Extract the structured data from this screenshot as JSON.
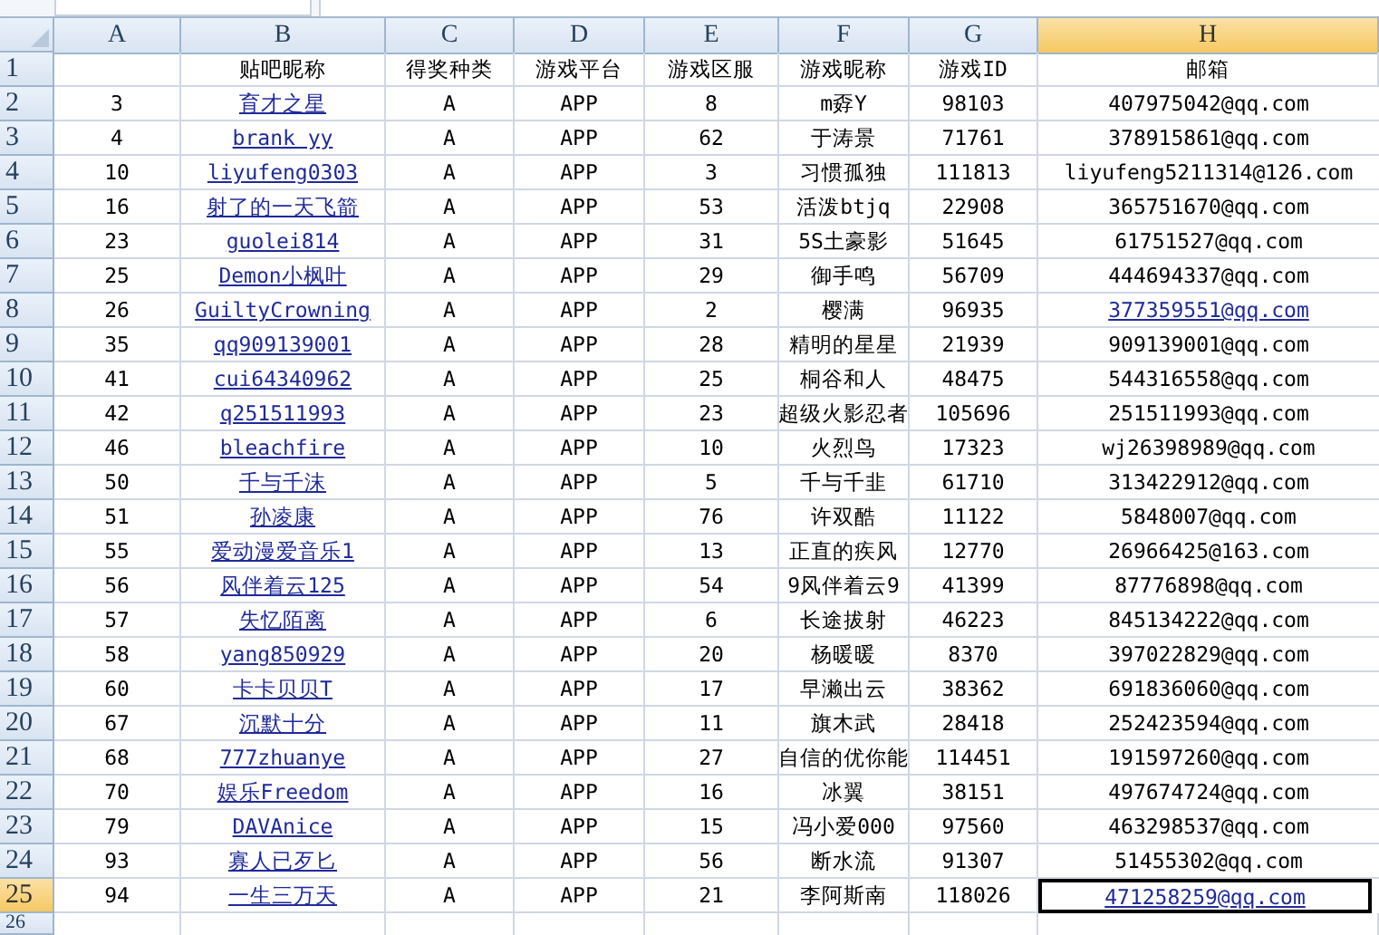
{
  "columns": [
    {
      "label": "A",
      "selected": false
    },
    {
      "label": "B",
      "selected": false
    },
    {
      "label": "C",
      "selected": false
    },
    {
      "label": "D",
      "selected": false
    },
    {
      "label": "E",
      "selected": false
    },
    {
      "label": "F",
      "selected": false
    },
    {
      "label": "G",
      "selected": false
    },
    {
      "label": "H",
      "selected": true
    }
  ],
  "header_row": {
    "number": "1",
    "titles": [
      "贴吧昵称",
      "得奖种类",
      "游戏平台",
      "游戏区服",
      "游戏昵称",
      "游戏ID",
      "邮箱"
    ]
  },
  "rows": [
    {
      "number": "2",
      "selected": false,
      "nickname_link": true,
      "email_link": false,
      "cells": [
        "3",
        "育才之星",
        "A",
        "APP",
        "8",
        "m孬Y",
        "98103",
        "407975042@qq.com"
      ]
    },
    {
      "number": "3",
      "selected": false,
      "nickname_link": true,
      "email_link": false,
      "cells": [
        "4",
        "brank yy",
        "A",
        "APP",
        "62",
        "于涛景",
        "71761",
        "378915861@qq.com"
      ]
    },
    {
      "number": "4",
      "selected": false,
      "nickname_link": true,
      "email_link": false,
      "cells": [
        "10",
        "liyufeng0303",
        "A",
        "APP",
        "3",
        "习惯孤独",
        "111813",
        "liyufeng5211314@126.com"
      ]
    },
    {
      "number": "5",
      "selected": false,
      "nickname_link": true,
      "email_link": false,
      "cells": [
        "16",
        "射了的一天飞箭",
        "A",
        "APP",
        "53",
        "活泼btjq",
        "22908",
        "365751670@qq.com"
      ]
    },
    {
      "number": "6",
      "selected": false,
      "nickname_link": true,
      "email_link": false,
      "cells": [
        "23",
        "guolei814",
        "A",
        "APP",
        "31",
        "5S土豪影",
        "51645",
        "61751527@qq.com"
      ]
    },
    {
      "number": "7",
      "selected": false,
      "nickname_link": true,
      "email_link": false,
      "cells": [
        "25",
        "Demon小枫叶",
        "A",
        "APP",
        "29",
        "御手鸣",
        "56709",
        "444694337@qq.com"
      ]
    },
    {
      "number": "8",
      "selected": false,
      "nickname_link": true,
      "email_link": true,
      "cells": [
        "26",
        "GuiltyCrowning",
        "A",
        "APP",
        "2",
        "樱满",
        "96935",
        "377359551@qq.com"
      ]
    },
    {
      "number": "9",
      "selected": false,
      "nickname_link": true,
      "email_link": false,
      "cells": [
        "35",
        "qq909139001",
        "A",
        "APP",
        "28",
        "精明的星星",
        "21939",
        "909139001@qq.com"
      ]
    },
    {
      "number": "10",
      "selected": false,
      "nickname_link": true,
      "email_link": false,
      "cells": [
        "41",
        "cui64340962",
        "A",
        "APP",
        "25",
        "桐谷和人",
        "48475",
        "544316558@qq.com"
      ]
    },
    {
      "number": "11",
      "selected": false,
      "nickname_link": true,
      "email_link": false,
      "cells": [
        "42",
        "q251511993",
        "A",
        "APP",
        "23",
        "超级火影忍者",
        "105696",
        "251511993@qq.com"
      ]
    },
    {
      "number": "12",
      "selected": false,
      "nickname_link": true,
      "email_link": false,
      "cells": [
        "46",
        "bleachfire",
        "A",
        "APP",
        "10",
        "火烈鸟",
        "17323",
        "wj26398989@qq.com"
      ]
    },
    {
      "number": "13",
      "selected": false,
      "nickname_link": true,
      "email_link": false,
      "cells": [
        "50",
        "千与千沫",
        "A",
        "APP",
        "5",
        "千与千韭",
        "61710",
        "313422912@qq.com"
      ]
    },
    {
      "number": "14",
      "selected": false,
      "nickname_link": true,
      "email_link": false,
      "cells": [
        "51",
        "孙凌康",
        "A",
        "APP",
        "76",
        "许双酷",
        "11122",
        "5848007@qq.com"
      ]
    },
    {
      "number": "15",
      "selected": false,
      "nickname_link": true,
      "email_link": false,
      "cells": [
        "55",
        "爱动漫爱音乐1",
        "A",
        "APP",
        "13",
        "正直的疾风",
        "12770",
        "26966425@163.com"
      ]
    },
    {
      "number": "16",
      "selected": false,
      "nickname_link": true,
      "email_link": false,
      "cells": [
        "56",
        "风伴着云125",
        "A",
        "APP",
        "54",
        "9风伴着云9",
        "41399",
        "87776898@qq.com"
      ]
    },
    {
      "number": "17",
      "selected": false,
      "nickname_link": true,
      "email_link": false,
      "cells": [
        "57",
        "失忆陌离",
        "A",
        "APP",
        "6",
        "长途拔射",
        "46223",
        "845134222@qq.com"
      ]
    },
    {
      "number": "18",
      "selected": false,
      "nickname_link": true,
      "email_link": false,
      "cells": [
        "58",
        "yang850929",
        "A",
        "APP",
        "20",
        "杨暖暖",
        "8370",
        "397022829@qq.com"
      ]
    },
    {
      "number": "19",
      "selected": false,
      "nickname_link": true,
      "email_link": false,
      "cells": [
        "60",
        "卡卡贝贝T",
        "A",
        "APP",
        "17",
        "早濑出云",
        "38362",
        "691836060@qq.com"
      ]
    },
    {
      "number": "20",
      "selected": false,
      "nickname_link": true,
      "email_link": false,
      "cells": [
        "67",
        "沉默十分",
        "A",
        "APP",
        "11",
        "旗木武",
        "28418",
        "252423594@qq.com"
      ]
    },
    {
      "number": "21",
      "selected": false,
      "nickname_link": true,
      "email_link": false,
      "cells": [
        "68",
        "777zhuanye",
        "A",
        "APP",
        "27",
        "自信的优你能",
        "114451",
        "191597260@qq.com"
      ]
    },
    {
      "number": "22",
      "selected": false,
      "nickname_link": true,
      "email_link": false,
      "cells": [
        "70",
        "娱乐Freedom",
        "A",
        "APP",
        "16",
        "冰翼",
        "38151",
        "497674724@qq.com"
      ]
    },
    {
      "number": "23",
      "selected": false,
      "nickname_link": true,
      "email_link": false,
      "cells": [
        "79",
        "DAVAnice",
        "A",
        "APP",
        "15",
        "冯小爱000",
        "97560",
        "463298537@qq.com"
      ]
    },
    {
      "number": "24",
      "selected": false,
      "nickname_link": true,
      "email_link": false,
      "cells": [
        "93",
        "寡人已歹匕",
        "A",
        "APP",
        "56",
        "断水流",
        "91307",
        "51455302@qq.com"
      ]
    },
    {
      "number": "25",
      "selected": true,
      "nickname_link": true,
      "email_link": true,
      "cells": [
        "94",
        "一生三万天",
        "A",
        "APP",
        "21",
        "李阿斯南",
        "118026",
        "471258259@qq.com"
      ]
    }
  ],
  "empty_rows": [
    "26"
  ]
}
